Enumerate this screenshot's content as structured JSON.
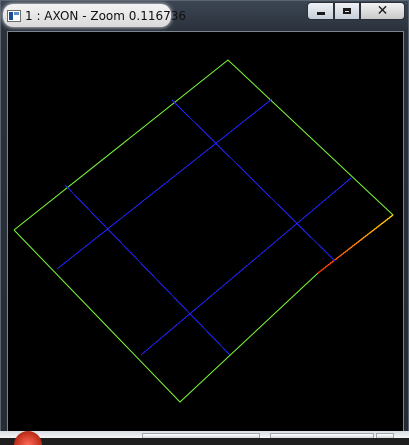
{
  "window": {
    "title": "1 : AXON - Zoom 0.116736"
  },
  "controls": {
    "minimize_label": "minimize",
    "maximize_label": "maximize",
    "close_label": "close"
  },
  "colors": {
    "outline": "#7cfc3a",
    "grid": "#2222ff",
    "highlight_start": "#ffd200",
    "highlight_end": "#ff2a00",
    "background": "#000000"
  },
  "icons": [
    "app-icon",
    "minimize-icon",
    "maximize-icon",
    "close-icon"
  ]
}
